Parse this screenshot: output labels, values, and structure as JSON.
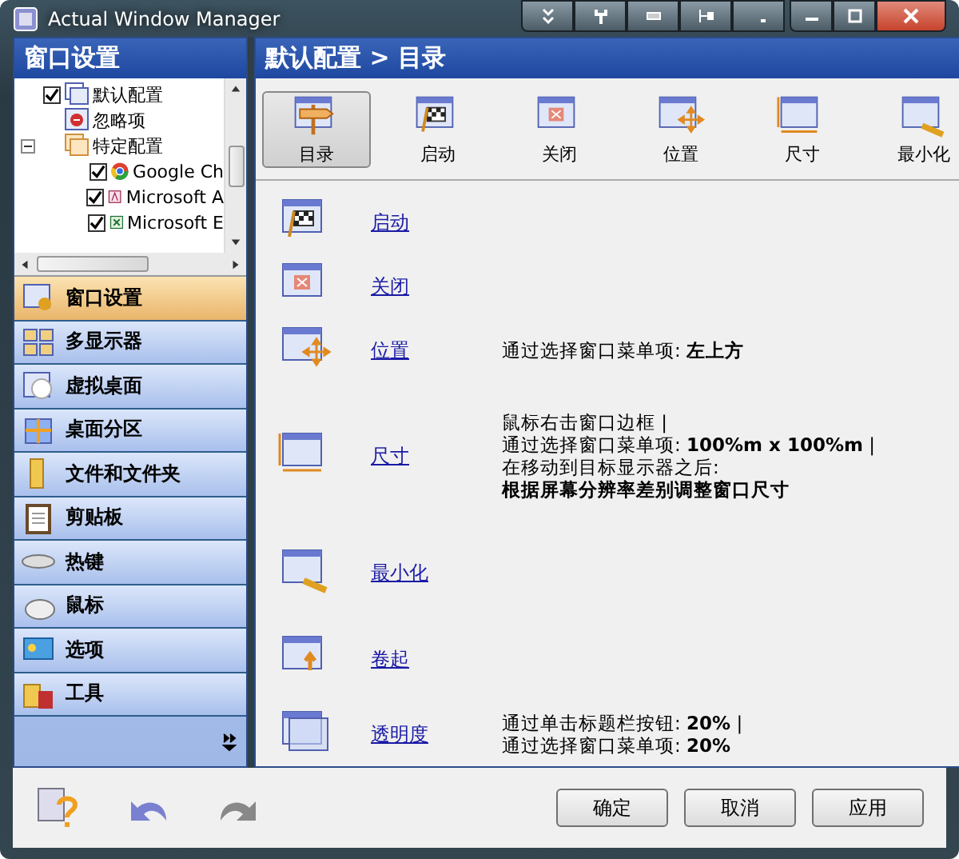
{
  "window": {
    "title": "Actual Window Manager"
  },
  "left_panel": {
    "title": "窗口设置",
    "tree": [
      {
        "label": "默认配置",
        "checked": true
      },
      {
        "label": "忽略项"
      },
      {
        "label": "特定配置",
        "expanded": true,
        "children": [
          {
            "label": "Google Ch",
            "checked": true
          },
          {
            "label": "Microsoft A",
            "checked": true
          },
          {
            "label": "Microsoft E",
            "checked": true
          }
        ]
      }
    ],
    "nav": [
      {
        "label": "窗口设置",
        "selected": true
      },
      {
        "label": "多显示器",
        "selected": false
      },
      {
        "label": "虚拟桌面",
        "selected": false
      },
      {
        "label": "桌面分区",
        "selected": false
      },
      {
        "label": "文件和文件夹",
        "selected": false
      },
      {
        "label": "剪贴板",
        "selected": false
      },
      {
        "label": "热键",
        "selected": false
      },
      {
        "label": "鼠标",
        "selected": false
      },
      {
        "label": "选项",
        "selected": false
      },
      {
        "label": "工具",
        "selected": false
      }
    ]
  },
  "right_panel": {
    "title": "默认配置 > 目录",
    "toolbar": [
      {
        "label": "目录",
        "selected": true
      },
      {
        "label": "启动",
        "selected": false
      },
      {
        "label": "关闭",
        "selected": false
      },
      {
        "label": "位置",
        "selected": false
      },
      {
        "label": "尺寸",
        "selected": false
      },
      {
        "label": "最小化",
        "selected": false
      }
    ],
    "rows": [
      {
        "link": "启动"
      },
      {
        "link": "关闭"
      },
      {
        "link": "位置",
        "lines": [
          "通过选择窗口菜单项: **左上方**"
        ]
      },
      {
        "link": "尺寸",
        "lines": [
          "鼠标右击窗口边框 |",
          "通过选择窗口菜单项: **100%m x 100%m** |",
          "在移动到目标显示器之后:"
        ],
        "bold_note": "根据屏幕分辨率差别调整窗口尺寸"
      },
      {
        "link": "最小化"
      },
      {
        "link": "卷起"
      },
      {
        "link": "透明度",
        "lines": [
          "通过单击标题栏按钮: **20%** |",
          "通过选择窗口菜单项: **20%**"
        ]
      }
    ]
  },
  "buttons": [
    {
      "label": "确定"
    },
    {
      "label": "取消"
    },
    {
      "label": "应用"
    }
  ]
}
